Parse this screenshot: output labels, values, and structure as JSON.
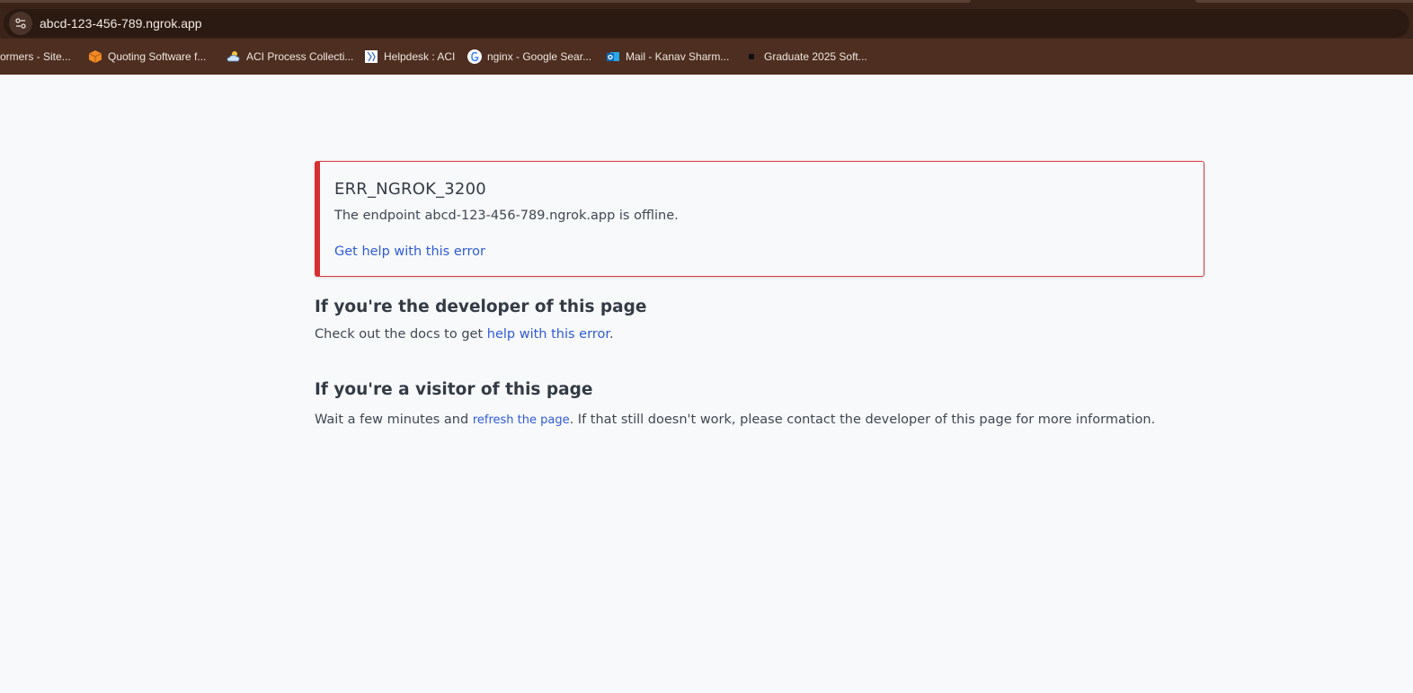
{
  "browser": {
    "url": "abcd-123-456-789.ngrok.app",
    "bookmarks": [
      {
        "label": "ormers - Site...",
        "icon": "bookmark-icon"
      },
      {
        "label": "Quoting Software f...",
        "icon": "box-icon"
      },
      {
        "label": "ACI Process Collecti...",
        "icon": "cloud-icon"
      },
      {
        "label": "Helpdesk : ACI",
        "icon": "helpdesk-icon"
      },
      {
        "label": "nginx - Google Sear...",
        "icon": "google-icon"
      },
      {
        "label": "Mail - Kanav Sharm...",
        "icon": "outlook-icon"
      },
      {
        "label": "Graduate 2025 Soft...",
        "icon": "square-icon"
      }
    ]
  },
  "error": {
    "code": "ERR_NGROK_3200",
    "message": "The endpoint abcd-123-456-789.ngrok.app is offline.",
    "help_link": "Get help with this error"
  },
  "developer": {
    "heading": "If you're the developer of this page",
    "text_before": "Check out the docs to get ",
    "link": "help with this error",
    "text_after": "."
  },
  "visitor": {
    "heading": "If you're a visitor of this page",
    "text_before": "Wait a few minutes and ",
    "link": "refresh the page",
    "text_after": ". If that still doesn't work, please contact the developer of this page for more information."
  },
  "colors": {
    "chrome_bg": "#3a241a",
    "bookmarks_bg": "#4d2e20",
    "page_bg": "#f8f9fb",
    "error_accent": "#d63031",
    "link": "#2f5bd3"
  }
}
